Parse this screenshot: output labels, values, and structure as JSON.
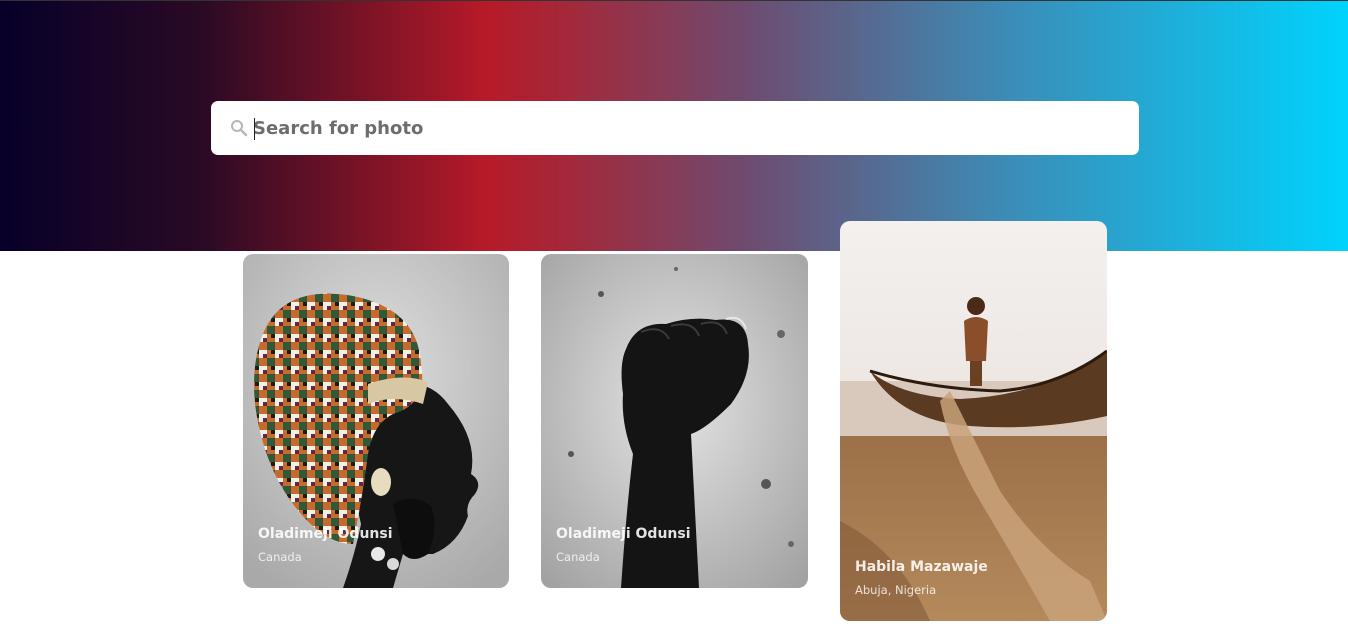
{
  "search": {
    "placeholder": "Search for photo",
    "value": ""
  },
  "photos": [
    {
      "photographer": "Oladimeji Odunsi",
      "location": "Canada",
      "subject_icon": "portrait-headwrap-photo"
    },
    {
      "photographer": "Oladimeji Odunsi",
      "location": "Canada",
      "subject_icon": "raised-fist-photo"
    },
    {
      "photographer": "Habila Mazawaje",
      "location": "Abuja, Nigeria",
      "subject_icon": "boy-canoe-beach-photo"
    }
  ],
  "colors": {
    "hero_gradient": [
      "#07002a",
      "#b61a28",
      "#00d3fd"
    ],
    "search_bg": "#ffffff",
    "caption_text": "#ffffff"
  }
}
